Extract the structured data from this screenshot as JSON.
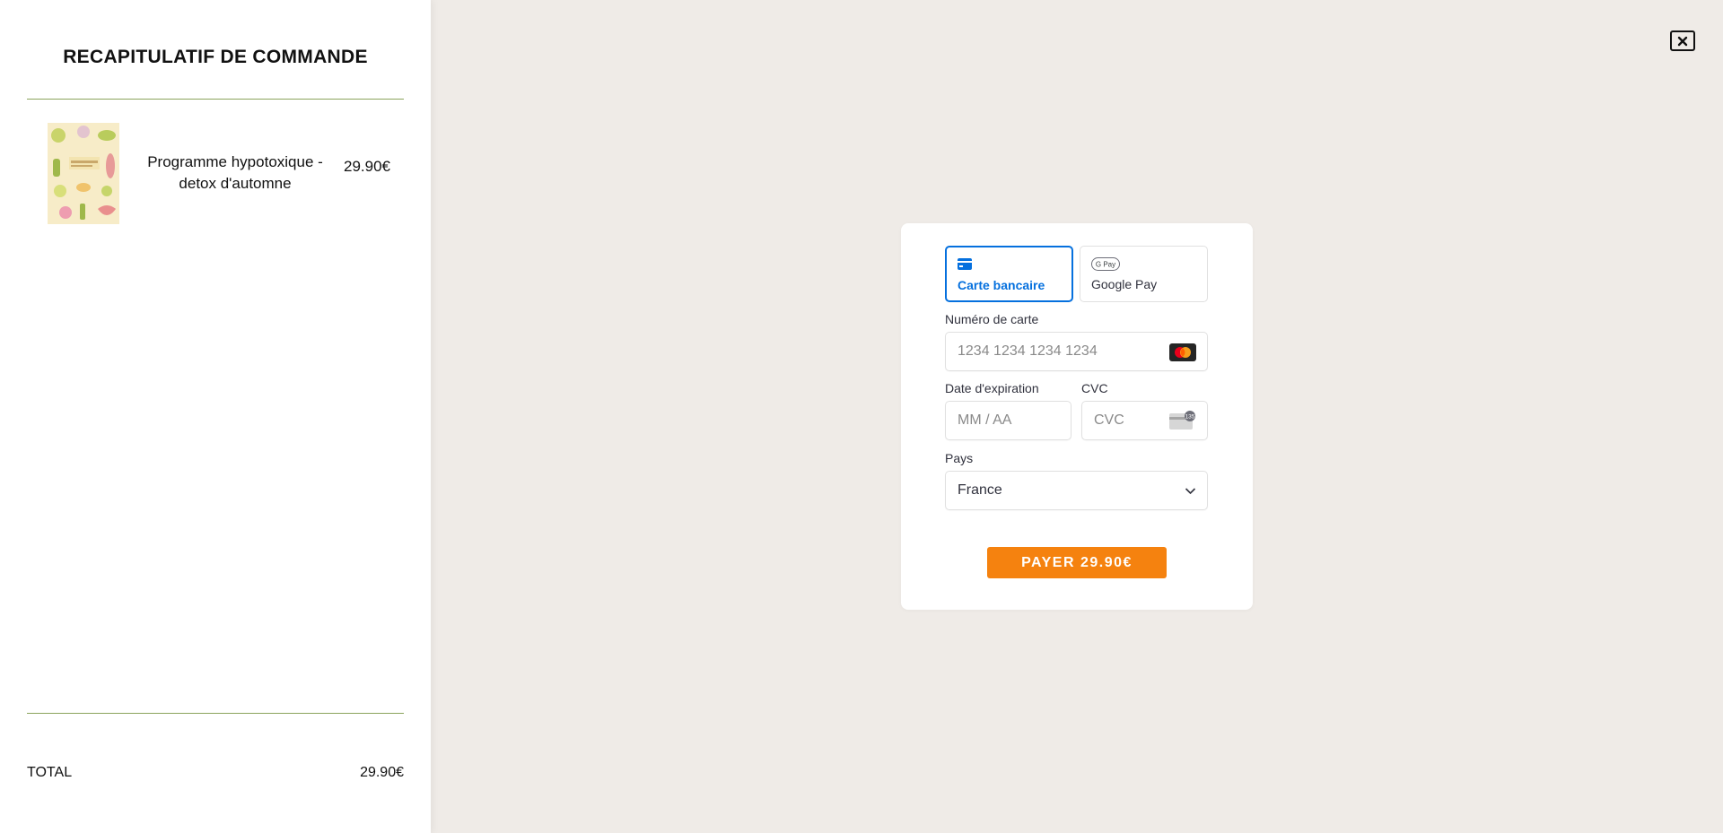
{
  "summary": {
    "title": "RECAPITULATIF DE COMMANDE",
    "item": {
      "name": "Programme hypotoxique - detox d'automne",
      "price": "29.90€"
    },
    "total_label": "TOTAL",
    "total_value": "29.90€"
  },
  "payment": {
    "tabs": [
      {
        "label": "Carte bancaire",
        "icon": "credit-card-icon",
        "selected": true
      },
      {
        "label": "Google Pay",
        "icon": "google-pay-icon",
        "icon_text": "G Pay",
        "selected": false
      }
    ],
    "card_number": {
      "label": "Numéro de carte",
      "placeholder": "1234 1234 1234 1234"
    },
    "expiry": {
      "label": "Date d'expiration",
      "placeholder": "MM / AA"
    },
    "cvc": {
      "label": "CVC",
      "placeholder": "CVC",
      "icon_text": "135"
    },
    "country": {
      "label": "Pays",
      "value": "France"
    },
    "pay_button_label": "PAYER 29.90€"
  },
  "colors": {
    "accent": "#0570de",
    "button": "#f5820f",
    "rule": "#8aa35c",
    "background": "#efebe7"
  }
}
